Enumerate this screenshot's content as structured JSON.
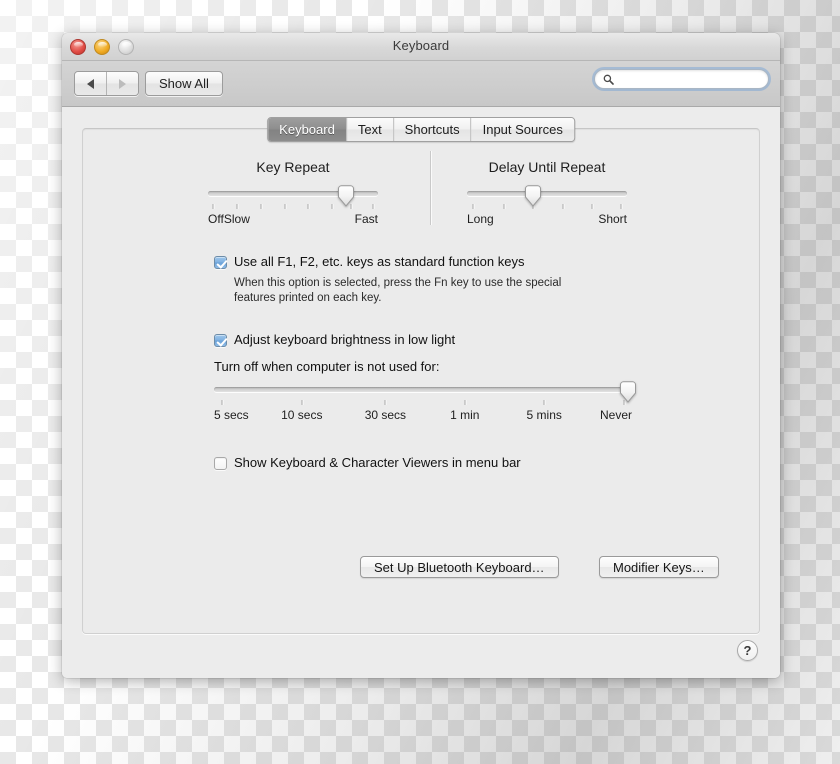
{
  "window": {
    "title": "Keyboard",
    "traffic_lights": [
      "close",
      "minimize",
      "zoom"
    ]
  },
  "toolbar": {
    "back_icon": "triangle-left-icon",
    "forward_icon": "triangle-right-icon",
    "show_all_label": "Show All",
    "search": {
      "icon": "search-icon",
      "value": "",
      "placeholder": ""
    }
  },
  "tabs": [
    {
      "label": "Keyboard",
      "active": true
    },
    {
      "label": "Text",
      "active": false
    },
    {
      "label": "Shortcuts",
      "active": false
    },
    {
      "label": "Input Sources",
      "active": false
    }
  ],
  "key_repeat": {
    "title": "Key Repeat",
    "value_percent": 81,
    "tick_count": 8,
    "labels": {
      "off": "Off",
      "slow": "Slow",
      "fast": "Fast"
    }
  },
  "delay_until_repeat": {
    "title": "Delay Until Repeat",
    "value_percent": 41,
    "tick_count": 6,
    "labels": {
      "long": "Long",
      "short": "Short"
    }
  },
  "function_keys": {
    "checked": true,
    "label": "Use all F1, F2, etc. keys as standard function keys",
    "help_line_1": "When this option is selected, press the Fn key to use the special",
    "help_line_2": "features printed on each key."
  },
  "brightness": {
    "checked": true,
    "label": "Adjust keyboard brightness in low light",
    "turn_off_label": "Turn off when computer is not used for:",
    "slider": {
      "value_percent": 100,
      "tick_labels": [
        "5 secs",
        "10 secs",
        "30 secs",
        "1 min",
        "5 mins",
        "Never"
      ]
    }
  },
  "viewers": {
    "checked": false,
    "label": "Show Keyboard & Character Viewers in menu bar"
  },
  "buttons": {
    "bluetooth": "Set Up Bluetooth Keyboard…",
    "modifier": "Modifier Keys…",
    "help": "?"
  },
  "colors": {
    "accent_checkbox": "#7fb0e0",
    "window_bg": "#ececec",
    "panel_bg": "#ebebeb",
    "active_tab_bg": "#8d8d8d"
  }
}
